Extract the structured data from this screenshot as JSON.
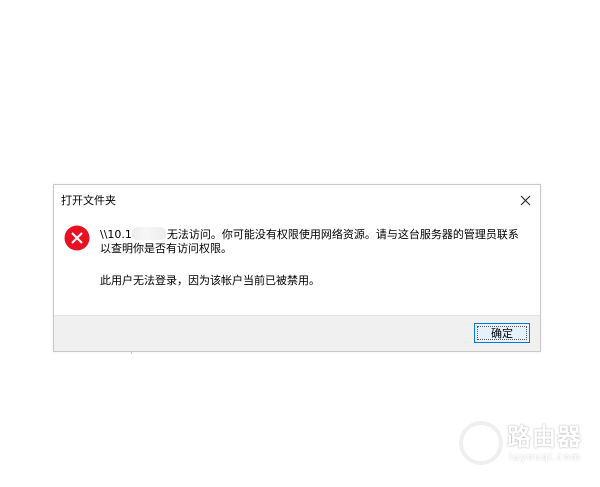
{
  "dialog": {
    "title": "打开文件夹",
    "close_label": "✕",
    "message_prefix": "\\\\10.1",
    "message_rest": "无法访问。你可能没有权限使用网络资源。请与这台服务器的管理员联系以查明你是否有访问权限。",
    "detail": "此用户无法登录，因为该帐户当前已被禁用。",
    "ok_label": "确定",
    "icon": "error-icon"
  },
  "watermark": {
    "name": "路由器",
    "url": "luyouqi.com"
  },
  "colors": {
    "error_red": "#e81123",
    "accent": "#0078d7",
    "footer_bg": "#f0f0f0"
  }
}
